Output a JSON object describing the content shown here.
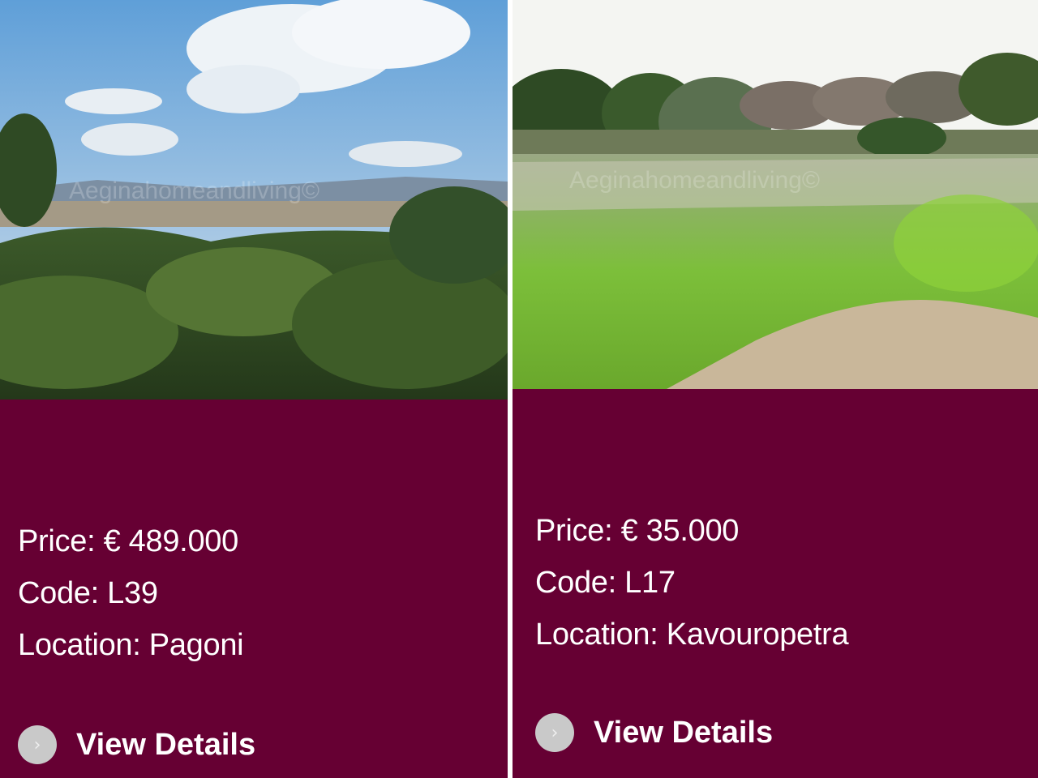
{
  "listings": [
    {
      "image_alt": "Aeginahomeandliving",
      "watermark": "Aeginahomeandliving©",
      "price": "Price: € 489.000",
      "code": "Code: L39",
      "location": "Location: Pagoni",
      "cta_label": "View Details"
    },
    {
      "image_alt": "Aeginahomeandliving",
      "watermark": "Aeginahomeandliving©",
      "price": "Price: € 35.000",
      "code": "Code: L17",
      "location": "Location: Kavouropetra",
      "cta_label": "View Details"
    }
  ],
  "colors": {
    "card_background": "#660033",
    "text": "#ffffff",
    "arrow_circle": "#c9c9c9"
  },
  "icons": {
    "cta_icon": "chevron-right-circle-icon",
    "cta_glyph": "›"
  }
}
